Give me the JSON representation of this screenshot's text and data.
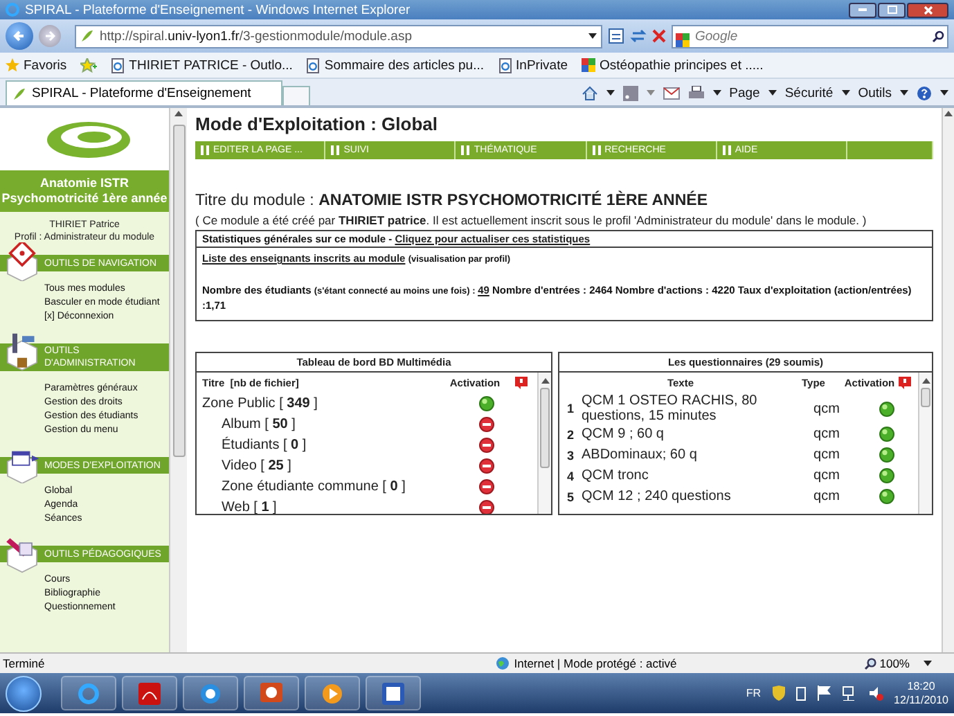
{
  "window": {
    "title": "SPIRAL - Plateforme d'Enseignement - Windows Internet Explorer"
  },
  "address_bar": {
    "url": "http://spiral.**univ-lyon1.fr**/3-gestionmodule/module.asp"
  },
  "search": {
    "placeholder": "Google"
  },
  "favorites_bar": {
    "label": "Favoris",
    "links": [
      {
        "kind": "page",
        "label": "THIRIET PATRICE - Outlo..."
      },
      {
        "kind": "page",
        "label": "Sommaire des articles pu..."
      },
      {
        "kind": "page",
        "label": "InPrivate"
      },
      {
        "kind": "google",
        "label": "Ostéopathie principes et ....."
      }
    ]
  },
  "tab": {
    "title": "SPIRAL - Plateforme d'Enseignement"
  },
  "command_bar": [
    "Page",
    "Sécurité",
    "Outils"
  ],
  "sidebar": {
    "course_title": [
      "Anatomie ISTR",
      "Psychomotricité 1ère année"
    ],
    "user_name": "THIRIET Patrice",
    "profile": "Profil : Administrateur du module",
    "sections": [
      {
        "kind": "navigation",
        "title": "OUTILS DE NAVIGATION",
        "items": [
          "Tous mes modules",
          "Basculer en mode étudiant",
          "[x]  Déconnexion"
        ]
      },
      {
        "kind": "administration",
        "title": "OUTILS D'ADMINISTRATION",
        "items": [
          "Paramètres généraux",
          "Gestion des droits",
          "Gestion des étudiants",
          "Gestion du menu"
        ]
      },
      {
        "kind": "modes",
        "title": "MODES D'EXPLOITATION",
        "items": [
          "Global",
          "Agenda",
          "Séances"
        ]
      },
      {
        "kind": "pedagogy",
        "title": "OUTILS PÉDAGOGIQUES",
        "items": [
          "Cours",
          "Bibliographie",
          "Questionnement"
        ]
      }
    ]
  },
  "main": {
    "heading": "Mode d'Exploitation : Global",
    "menu": [
      "EDITER LA PAGE ...",
      "SUIVI",
      "THÉMATIQUE",
      "RECHERCHE",
      "AIDE"
    ],
    "module_title": "Titre du module : **ANATOMIE ISTR PSYCHOMOTRICITÉ 1ÈRE ANNÉE**",
    "creator": "( Ce module a été créé par **THIRIET patrice**. Il est actuellement inscrit sous le profil 'Administrateur du module' dans le module. )",
    "stats": {
      "header": "Statistiques générales sur ce module - ",
      "refresh_link": "Cliquez pour actualiser ces statistiques",
      "teachers_link": "Liste des enseignants inscrits au module",
      "teachers_note": "(visualisation par profil)",
      "students_label": "Nombre des étudiants ",
      "students_note": "(s'étant connecté au moins une fois) : ",
      "students_count": "49",
      "rest": " Nombre d'entrées : 2464 Nombre d'actions : 4220 Taux d'exploitation (action/entrées) :1,71"
    },
    "media_table": {
      "title": "Tableau de bord BD Multimédia",
      "columns": [
        "Titre  [nb de fichier]",
        "Activation"
      ],
      "rows": [
        {
          "label": "Zone Public [ **349** ]",
          "active": true,
          "children": [
            {
              "label": "Album [ **50** ]",
              "active": false
            },
            {
              "label": "Étudiants [ **0** ]",
              "active": false
            },
            {
              "label": "Video [ **25** ]",
              "active": false
            },
            {
              "label": "Zone étudiante commune [ **0** ]",
              "active": false
            },
            {
              "label": "Web [ **1** ]",
              "active": false
            }
          ]
        }
      ]
    },
    "quiz_table": {
      "title": "Les questionnaires (29 soumis)",
      "columns": [
        "Texte",
        "Type",
        "Activation"
      ],
      "rows": [
        {
          "number": "1",
          "text": "QCM 1 OSTEO RACHIS, 80 questions, 15 minutes",
          "type": "qcm",
          "active": true
        },
        {
          "number": "2",
          "text": "QCM 9 ; 60 q",
          "type": "qcm",
          "active": true
        },
        {
          "number": "3",
          "text": "ABDominaux; 60 q",
          "type": "qcm",
          "active": true
        },
        {
          "number": "4",
          "text": "QCM tronc",
          "type": "qcm",
          "active": true
        },
        {
          "number": "5",
          "text": "QCM 12 ; 240 questions",
          "type": "qcm",
          "active": true
        }
      ]
    }
  },
  "status_bar": {
    "text": "Terminé",
    "zone": "Internet | Mode protégé : activé",
    "zoom": "100%"
  },
  "taskbar": {
    "language": "FR",
    "time": "18:20",
    "date": "12/11/2010"
  }
}
